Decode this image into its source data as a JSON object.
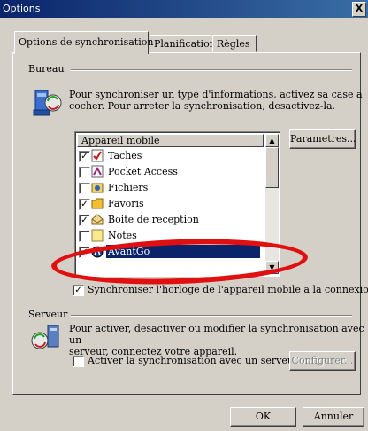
{
  "window": {
    "title": "Options",
    "close": "X"
  },
  "tabs": [
    "Options de synchronisation",
    "Planification",
    "Règles"
  ],
  "bureau": {
    "group_label": "Bureau",
    "description_line1": "Pour synchroniser un type d'informations, activez sa case a",
    "description_line2": "cocher. Pour arreter la synchronisation, desactivez-la.",
    "list_header": "Appareil mobile",
    "items": [
      {
        "label": "Taches",
        "checked": true,
        "icon": "tasks-icon"
      },
      {
        "label": "Pocket Access",
        "checked": false,
        "icon": "pocket-access-icon"
      },
      {
        "label": "Fichiers",
        "checked": false,
        "icon": "files-icon"
      },
      {
        "label": "Favoris",
        "checked": true,
        "icon": "favorites-folder-icon"
      },
      {
        "label": "Boite de reception",
        "checked": true,
        "icon": "inbox-icon"
      },
      {
        "label": "Notes",
        "checked": false,
        "icon": "notes-icon"
      },
      {
        "label": "AvantGo",
        "checked": true,
        "icon": "avantgo-icon",
        "selected": true
      }
    ],
    "params_button": "Parametres...",
    "sync_clock": "Synchroniser l'horloge de l'appareil mobile a la connexion"
  },
  "serveur": {
    "group_label": "Serveur",
    "description_line1": "Pour activer, desactiver ou modifier la synchronisation avec un",
    "description_line2": "serveur, connectez votre appareil.",
    "enable_server": "Activer la synchronisation avec un serveur",
    "configure_button": "Configurer..."
  },
  "footer": {
    "ok": "OK",
    "cancel": "Annuler"
  },
  "colors": {
    "title_bar": "#0a246a",
    "selection": "#0a246a",
    "callout": "#e01010",
    "face": "#d4d0c8"
  }
}
